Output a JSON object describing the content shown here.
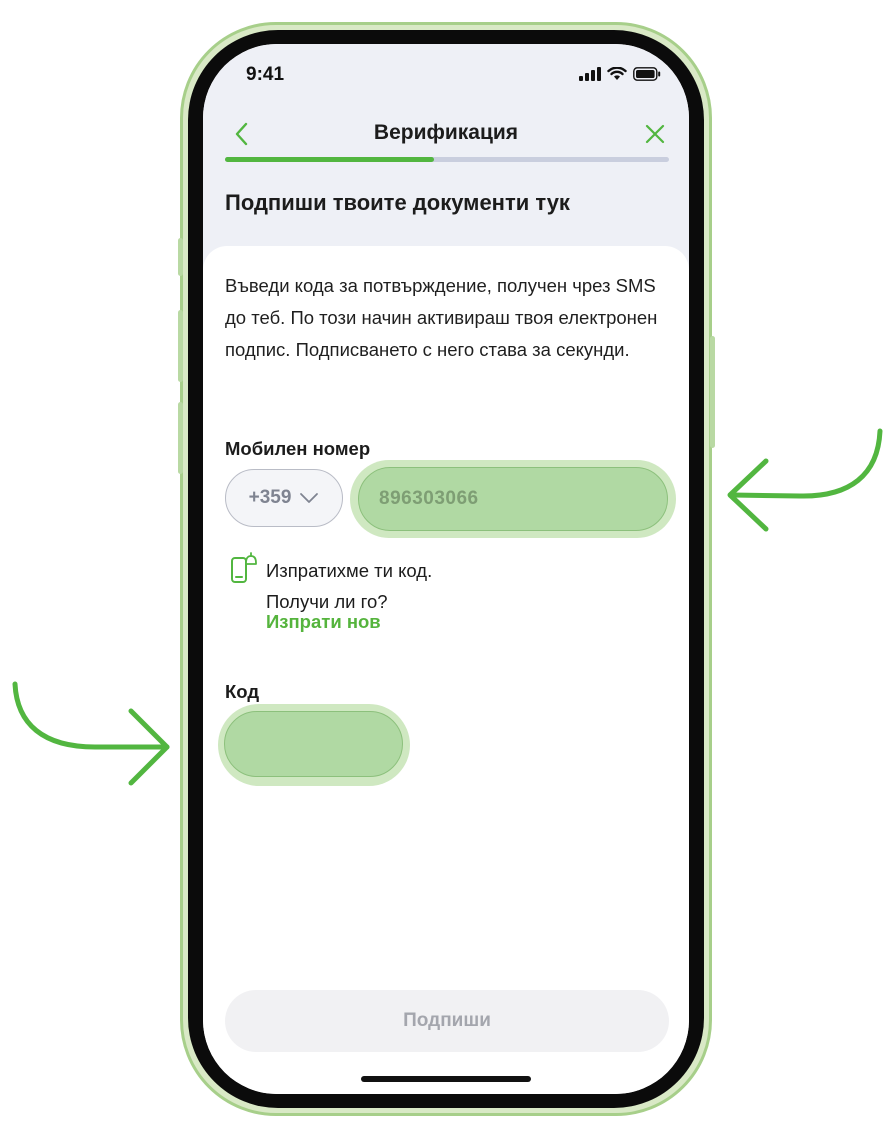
{
  "status_bar": {
    "time": "9:41"
  },
  "nav": {
    "title": "Верификация",
    "progress": 0.47
  },
  "heading": "Подпиши твоите документи тук",
  "description": "Въведи кода за потвърждение, получен чрез SMS до теб. По този начин активираш твоя електронен подпис. Подписването с него става за секунди.",
  "phone": {
    "label": "Мобилен номер",
    "country_code": "+359",
    "number": "896303066"
  },
  "sent": {
    "line1": "Изпратихме ти код.",
    "line2": "Получи ли го?",
    "resend": "Изпрати нов"
  },
  "code": {
    "label": "Код",
    "value": ""
  },
  "sign_button": "Подпиши",
  "colors": {
    "accent": "#52b640",
    "highlight": "#b0d9a3",
    "frame": "#a7cf8a"
  },
  "icons": [
    "chevron-left-icon",
    "close-icon",
    "chevron-down-icon",
    "phone-notification-icon",
    "signal-icon",
    "wifi-icon",
    "battery-icon",
    "arrow-icon"
  ]
}
